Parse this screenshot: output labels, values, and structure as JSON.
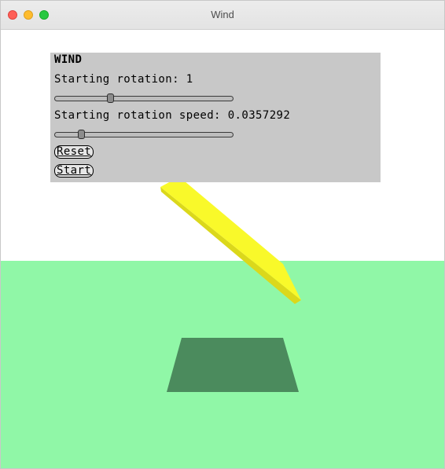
{
  "window": {
    "title": "Wind"
  },
  "panel": {
    "heading": "WIND",
    "rotation": {
      "label": "Starting rotation: 1",
      "slider_fraction": 0.31
    },
    "speed": {
      "label": "Starting rotation speed: 0.0357292",
      "slider_fraction": 0.15
    },
    "buttons": {
      "reset": "Reset",
      "start": "Start"
    }
  },
  "colors": {
    "ground": "#90f7a7",
    "shadow": "#4b8b5d",
    "board_top": "#f9f92a",
    "board_edge": "#dbd81b",
    "panel": "#c8c8c8"
  }
}
